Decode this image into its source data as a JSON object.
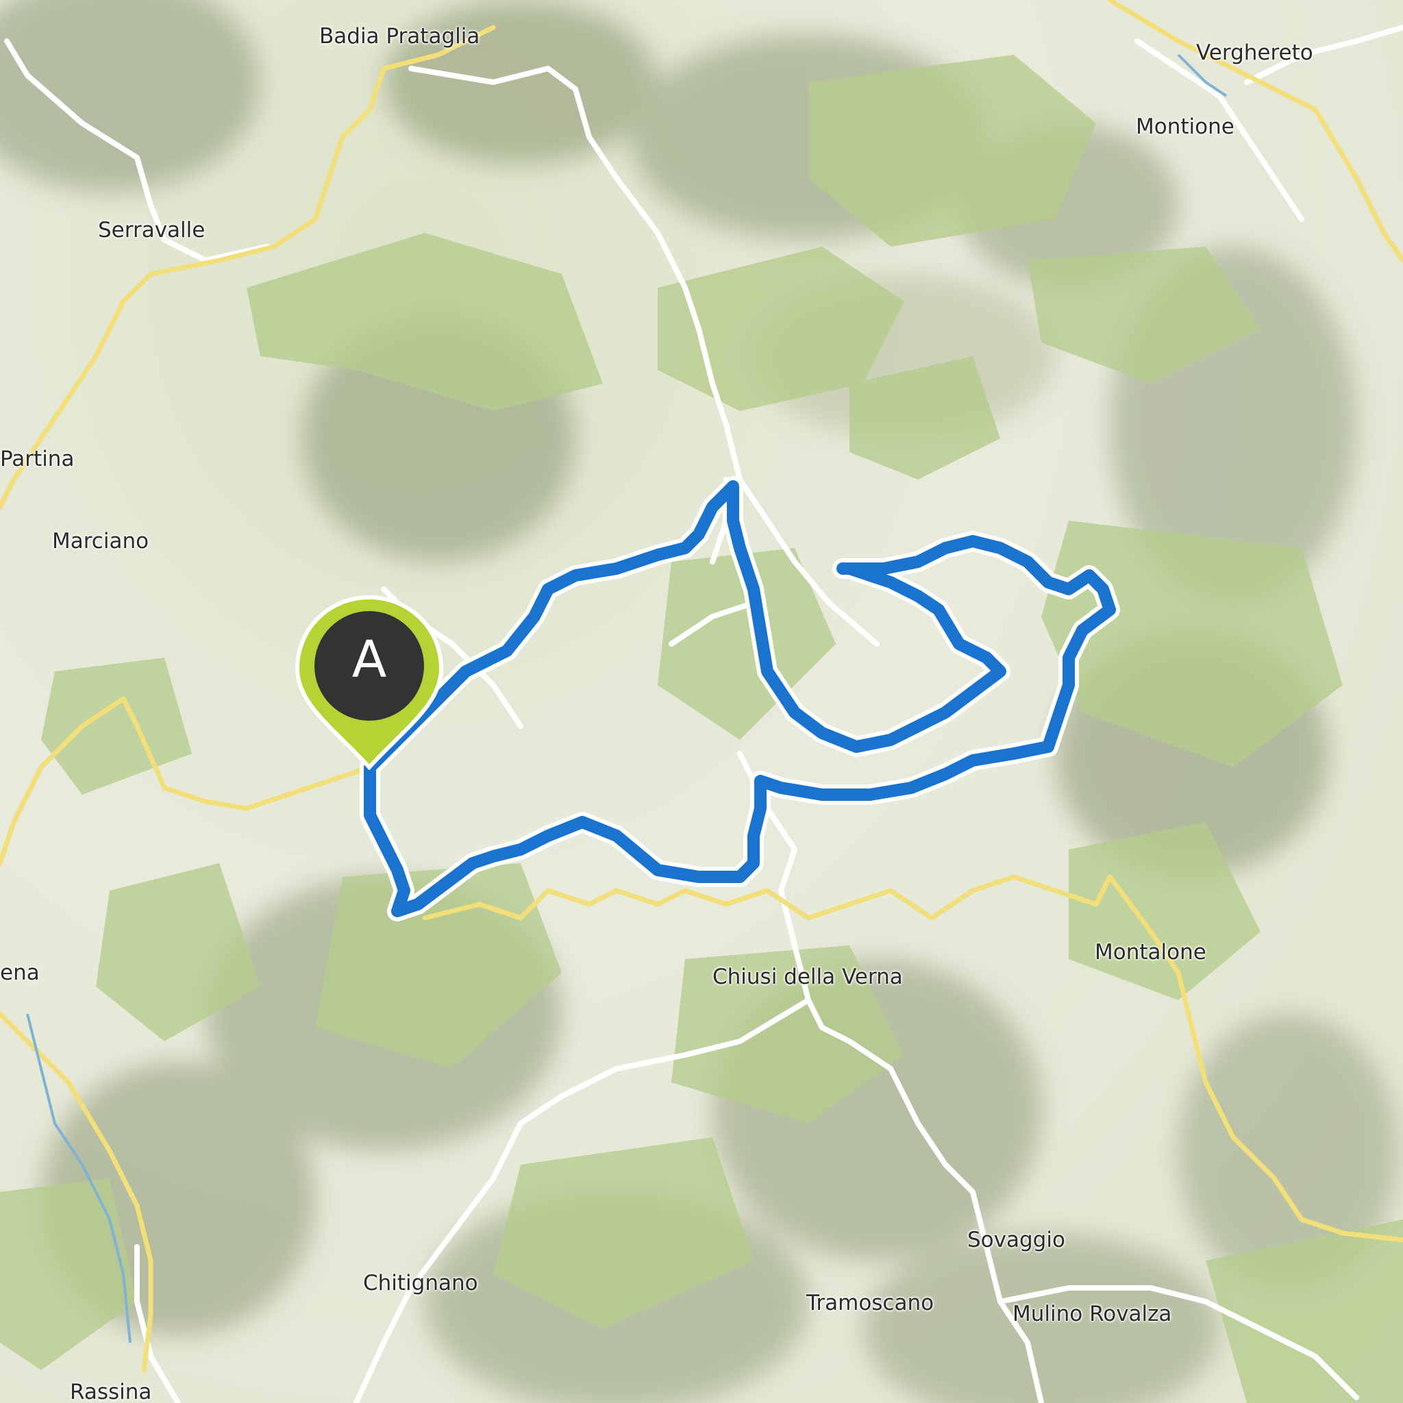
{
  "map": {
    "places": [
      {
        "id": "badia-prataglia",
        "label": "Badia Prataglia"
      },
      {
        "id": "verghereto",
        "label": "Verghereto"
      },
      {
        "id": "montione",
        "label": "Montione"
      },
      {
        "id": "serravalle",
        "label": "Serravalle"
      },
      {
        "id": "partina",
        "label": "Partina"
      },
      {
        "id": "marciano",
        "label": "Marciano"
      },
      {
        "id": "bibbiena",
        "label": "ena"
      },
      {
        "id": "chiusi-della-verna",
        "label": "Chiusi della Verna"
      },
      {
        "id": "montalone",
        "label": "Montalone"
      },
      {
        "id": "sovaggio",
        "label": "Sovaggio"
      },
      {
        "id": "chitignano",
        "label": "Chitignano"
      },
      {
        "id": "tramoscano",
        "label": "Tramoscano"
      },
      {
        "id": "mulino-rovalza",
        "label": "Mulino Rovalza"
      },
      {
        "id": "rassina",
        "label": "Rassina"
      }
    ],
    "start_marker": {
      "letter": "A",
      "color": "#b5d334"
    },
    "colors": {
      "route": "#1a73cf",
      "primary_road": "#f2df7a",
      "secondary_road": "#ffffff",
      "forest": "#b7cc8e"
    }
  }
}
